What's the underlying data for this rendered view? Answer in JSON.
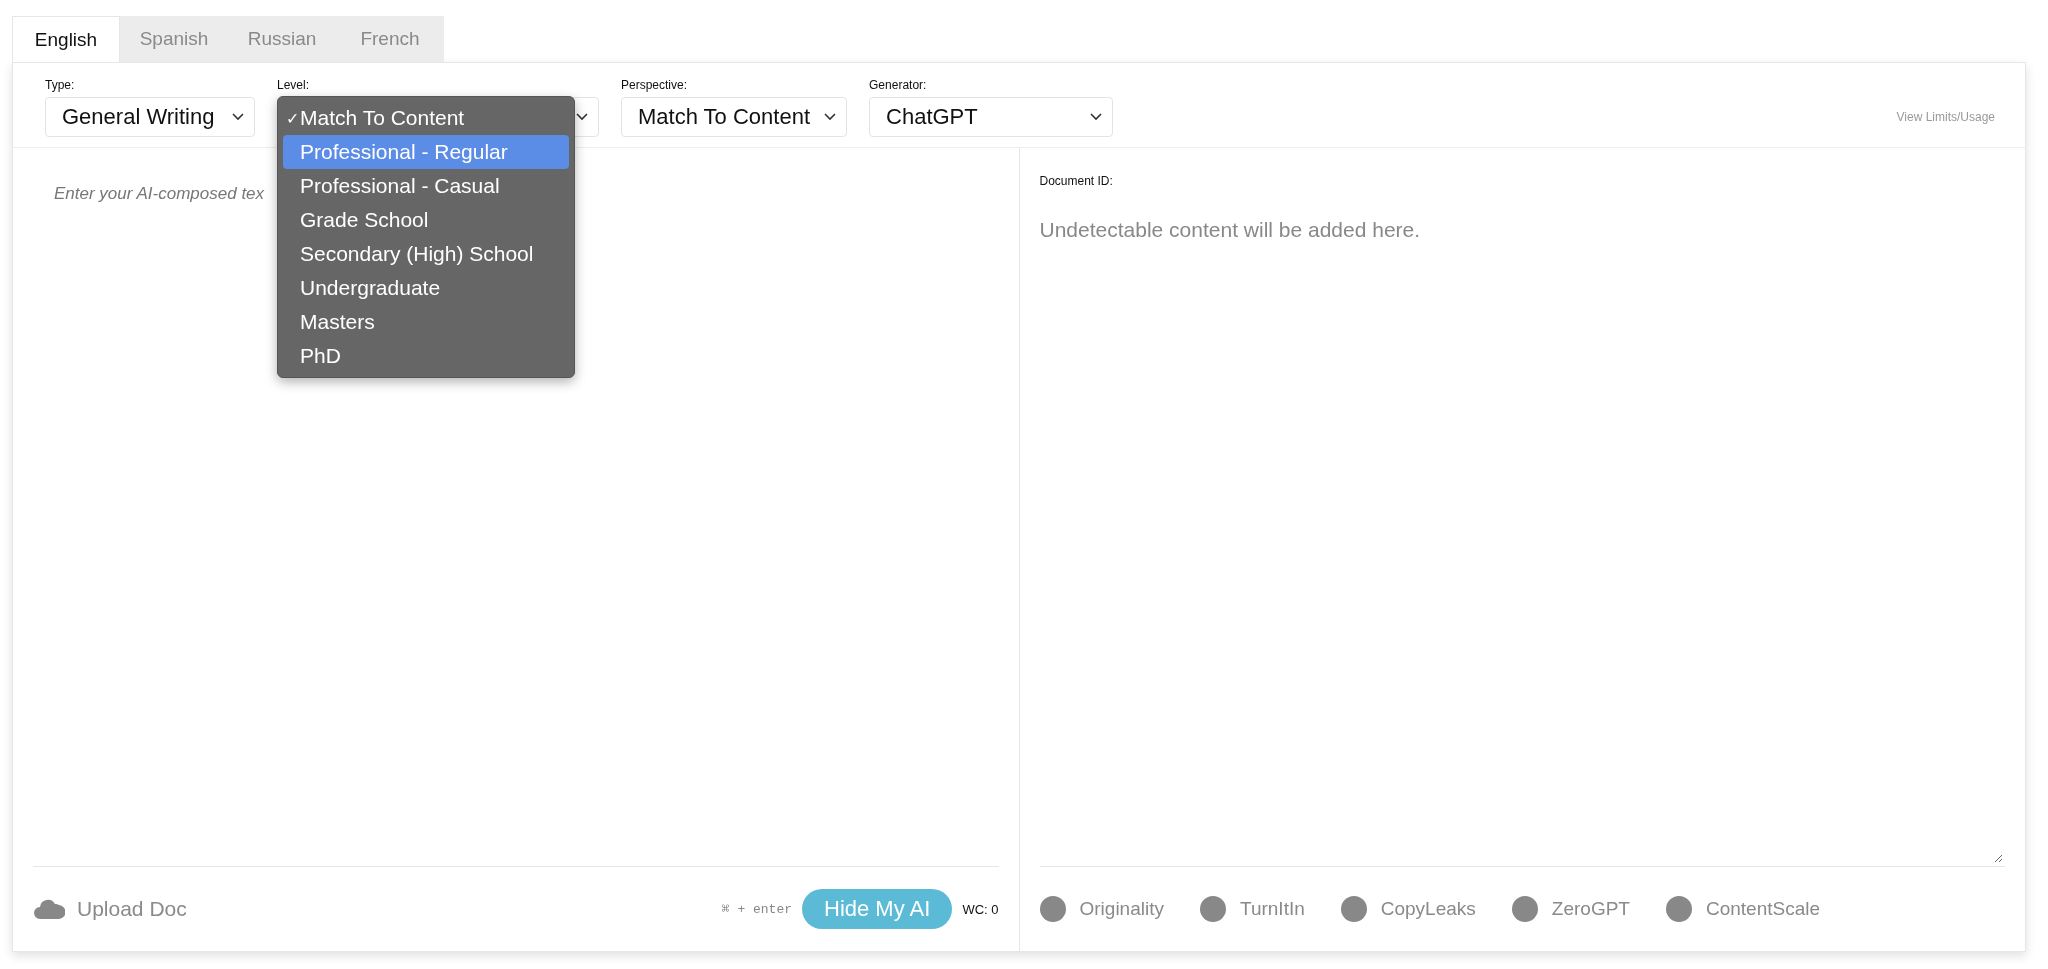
{
  "tabs": [
    {
      "label": "English",
      "selected": true
    },
    {
      "label": "Spanish",
      "selected": false
    },
    {
      "label": "Russian",
      "selected": false
    },
    {
      "label": "French",
      "selected": false
    }
  ],
  "toolbar": {
    "fields": [
      {
        "label": "Type:",
        "value": "General Writing"
      },
      {
        "label": "Level:",
        "tick": "✓",
        "menu": [
          {
            "label": "Match To Content",
            "checked": true,
            "highlighted": false
          },
          {
            "label": "Professional - Regular",
            "checked": false,
            "highlighted": true
          },
          {
            "label": "Professional - Casual",
            "checked": false,
            "highlighted": false
          },
          {
            "label": "Grade School",
            "checked": false,
            "highlighted": false
          },
          {
            "label": "Secondary (High) School",
            "checked": false,
            "highlighted": false
          },
          {
            "label": "Undergraduate",
            "checked": false,
            "highlighted": false
          },
          {
            "label": "Masters",
            "checked": false,
            "highlighted": false
          },
          {
            "label": "PhD",
            "checked": false,
            "highlighted": false
          }
        ]
      },
      {
        "label": "Perspective:",
        "value": "Match To Content"
      },
      {
        "label": "Generator:",
        "value": "ChatGPT"
      }
    ],
    "link": "View Limits/Usage"
  },
  "input_panel": {
    "placeholder": "Enter your AI-composed tex",
    "upload": "Upload Doc",
    "shortcut": "⌘ + enter",
    "button": "Hide My AI",
    "word_count": "WC: 0"
  },
  "output_panel": {
    "label": "Document ID:",
    "placeholder": "Undetectable content will be added here.",
    "detectors": [
      "Originality",
      "TurnItIn",
      "CopyLeaks",
      "ZeroGPT",
      "ContentScale"
    ]
  }
}
